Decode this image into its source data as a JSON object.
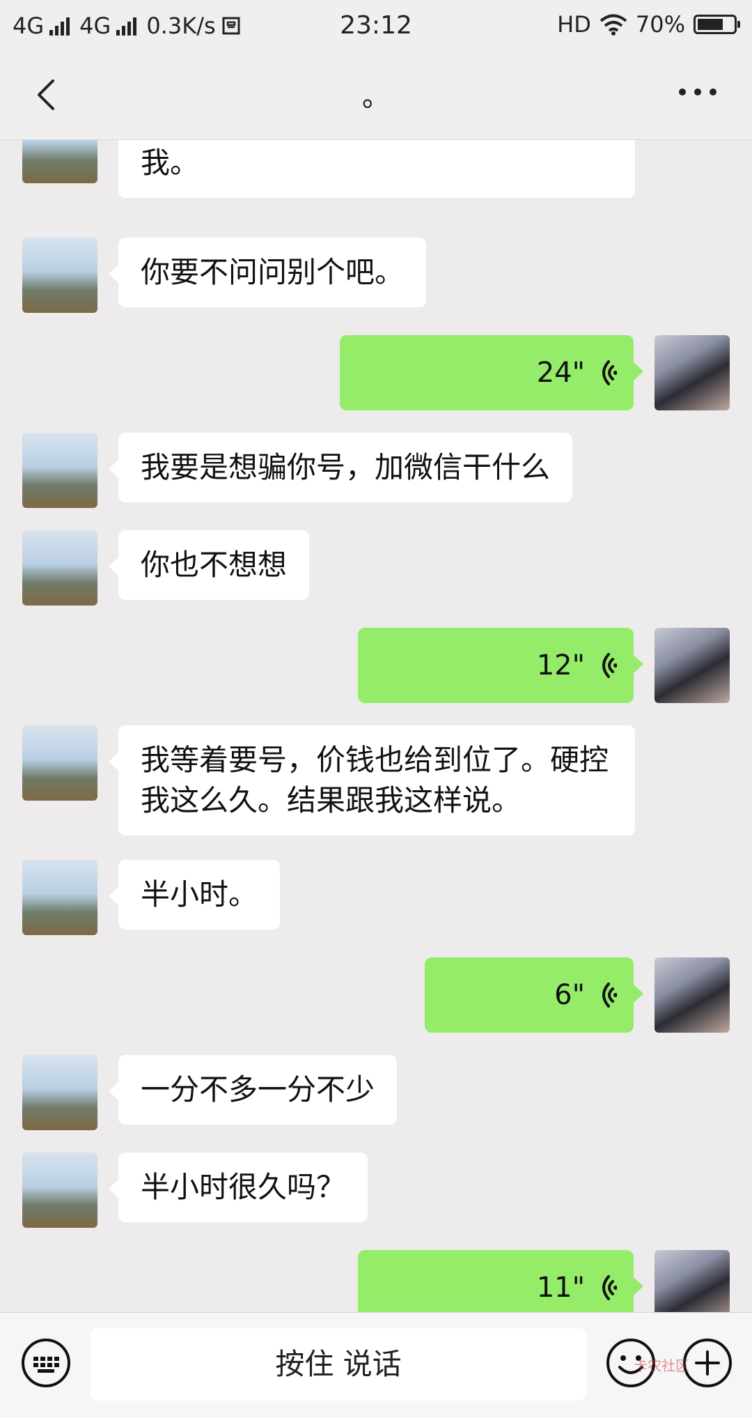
{
  "status": {
    "left_net1": "4G",
    "left_net2": "4G",
    "speed": "0.3K/s",
    "time": "23:12",
    "hd": "HD",
    "battery": "70%"
  },
  "header": {
    "title": "。"
  },
  "messages": [
    {
      "side": "them",
      "text": "哎哟我也是实在不知道该怎么让你信我。"
    },
    {
      "side": "them",
      "text": "你要不问问别个吧。"
    },
    {
      "side": "me",
      "voice": "24\""
    },
    {
      "side": "them",
      "text": "我要是想骗你号，加微信干什么"
    },
    {
      "side": "them",
      "text": "你也不想想"
    },
    {
      "side": "me",
      "voice": "12\""
    },
    {
      "side": "them",
      "text": "我等着要号，价钱也给到位了。硬控我这么久。结果跟我这样说。"
    },
    {
      "side": "them",
      "text": "半小时。"
    },
    {
      "side": "me",
      "voice": "6\""
    },
    {
      "side": "them",
      "text": "一分不多一分不少"
    },
    {
      "side": "them",
      "text": "半小时很久吗？"
    },
    {
      "side": "me",
      "voice": "11\""
    }
  ],
  "bottom": {
    "hold_to_talk": "按住 说话",
    "watermark": "卡农社区"
  },
  "colors": {
    "my_bubble": "#95ec69",
    "their_bubble": "#ffffff",
    "background": "#edebeb"
  }
}
